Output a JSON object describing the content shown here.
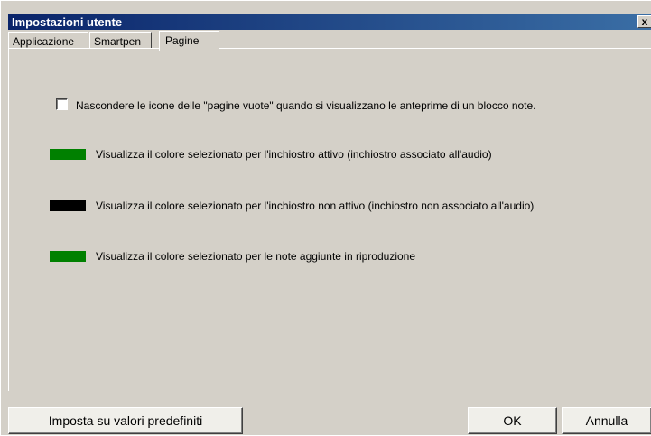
{
  "window": {
    "title": "Impostazioni utente",
    "close_label": "x"
  },
  "tabs": [
    {
      "label": "Applicazione"
    },
    {
      "label": "Smartpen"
    },
    {
      "label": "Pagine"
    }
  ],
  "options": {
    "hide_empty_pages": {
      "label": "Nascondere le icone delle \"pagine vuote\" quando si visualizzano le anteprime di un blocco note.",
      "checked": false
    },
    "active_ink": {
      "label": "Visualizza il colore selezionato per l'inchiostro attivo (inchiostro associato all'audio)",
      "color": "#008000"
    },
    "inactive_ink": {
      "label": "Visualizza il colore selezionato per l'inchiostro non attivo (inchiostro non associato all'audio)",
      "color": "#000000"
    },
    "playback_notes": {
      "label": "Visualizza il colore selezionato per le note aggiunte in riproduzione",
      "color": "#008000"
    }
  },
  "buttons": {
    "defaults": "Imposta su valori predefiniti",
    "ok": "OK",
    "cancel": "Annulla"
  }
}
